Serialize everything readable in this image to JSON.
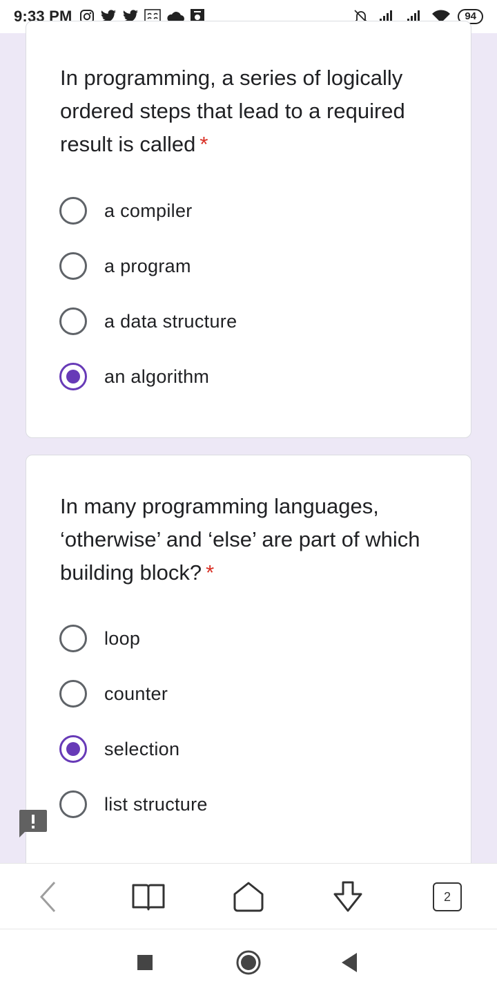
{
  "status_bar": {
    "time": "9:33 PM",
    "battery": "94",
    "left_icons": [
      "instagram-icon",
      "twitter-icon",
      "twitter-icon",
      "news-icon",
      "cloud-icon",
      "gallery-icon"
    ],
    "right_icons": [
      "mute-icon",
      "signal-icon",
      "signal-icon",
      "wifi-icon"
    ]
  },
  "questions": [
    {
      "text": "In programming, a series of logically ordered steps that lead to a required result is called",
      "required_mark": "*",
      "options": [
        {
          "label": "a compiler",
          "checked": false
        },
        {
          "label": "a program",
          "checked": false
        },
        {
          "label": "a data structure",
          "checked": false
        },
        {
          "label": "an algorithm",
          "checked": true
        }
      ]
    },
    {
      "text": "In many programming languages, ‘otherwise’ and ‘else’ are part of which building block?",
      "required_mark": "*",
      "options": [
        {
          "label": "loop",
          "checked": false
        },
        {
          "label": "counter",
          "checked": false
        },
        {
          "label": "selection",
          "checked": true
        },
        {
          "label": "list structure",
          "checked": false
        }
      ]
    }
  ],
  "browser_toolbar": {
    "tab_count": "2",
    "buttons": [
      "back-icon",
      "bookmarks-icon",
      "home-icon",
      "download-icon",
      "tabs-icon"
    ]
  },
  "colors": {
    "accent": "#673ab7",
    "background": "#ede8f6",
    "required": "#d93025"
  }
}
